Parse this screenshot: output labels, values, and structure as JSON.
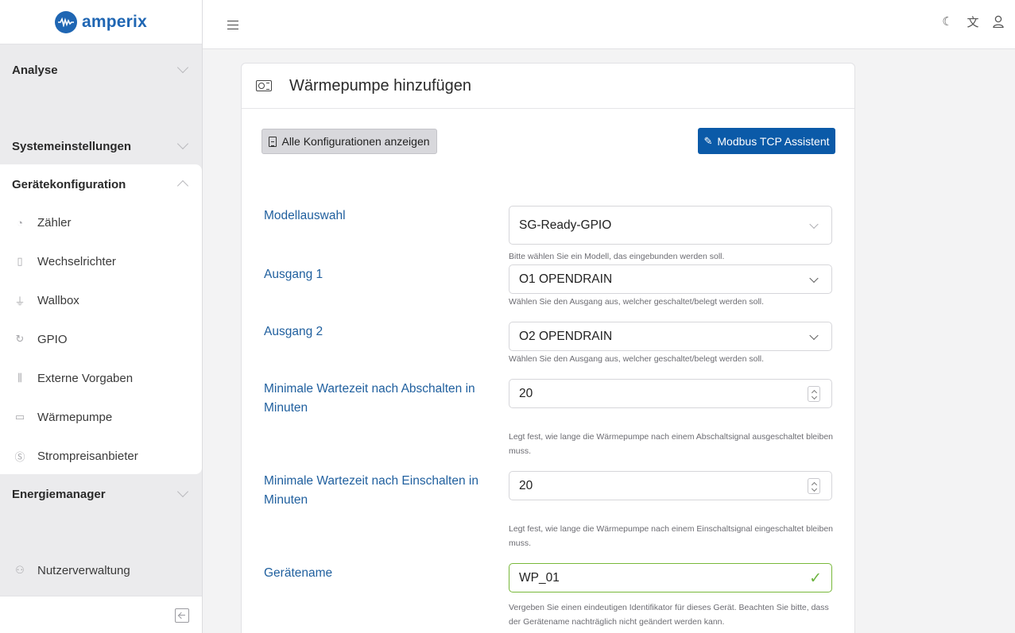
{
  "app": {
    "logo_text": "amperix"
  },
  "sidebar": {
    "sections": [
      {
        "label": "Analyse"
      },
      {
        "label": "Systemeinstellungen"
      },
      {
        "label": "Gerätekonfiguration"
      },
      {
        "label": "Energiemanager"
      }
    ],
    "device_items": [
      {
        "label": "Zähler",
        "icon": "gauge-icon"
      },
      {
        "label": "Wechselrichter",
        "icon": "inverter-icon"
      },
      {
        "label": "Wallbox",
        "icon": "plug-icon"
      },
      {
        "label": "GPIO",
        "icon": "refresh-icon"
      },
      {
        "label": "Externe Vorgaben",
        "icon": "sliders-icon"
      },
      {
        "label": "Wärmepumpe",
        "icon": "heat-pump-icon"
      },
      {
        "label": "Strompreisanbieter",
        "icon": "dollar-icon"
      }
    ],
    "user_management": "Nutzerverwaltung"
  },
  "card": {
    "title": "Wärmepumpe hinzufügen",
    "show_configs_button": "Alle Konfigurationen anzeigen",
    "modbus_button": "Modbus TCP Assistent"
  },
  "form": {
    "model": {
      "label": "Modellauswahl",
      "value": "SG-Ready-GPIO",
      "help": "Bitte wählen Sie ein Modell, das eingebunden werden soll."
    },
    "output1": {
      "label": "Ausgang 1",
      "value": "O1 OPENDRAIN",
      "help": "Wählen Sie den Ausgang aus, welcher geschaltet/belegt werden soll."
    },
    "output2": {
      "label": "Ausgang 2",
      "value": "O2 OPENDRAIN",
      "help": "Wählen Sie den Ausgang aus, welcher geschaltet/belegt werden soll."
    },
    "min_off": {
      "label": "Minimale Wartezeit nach Abschalten in Minuten",
      "value": "20",
      "help": "Legt fest, wie lange die Wärmepumpe nach einem Abschaltsignal ausgeschaltet bleiben muss."
    },
    "min_on": {
      "label": "Minimale Wartezeit nach Einschalten in Minuten",
      "value": "20",
      "help": "Legt fest, wie lange die Wärmepumpe nach einem Einschaltsignal eingeschaltet bleiben muss."
    },
    "device_name": {
      "label": "Gerätename",
      "value": "WP_01",
      "help": "Vergeben Sie einen eindeutigen Identifikator für dieses Gerät. Beachten Sie bitte, dass der Gerätename nachträglich nicht geändert werden kann."
    }
  },
  "colors": {
    "brand": "#1f66b3",
    "primary_button": "#0b5aa8",
    "label": "#1f5f9e",
    "valid": "#6cb33e"
  }
}
